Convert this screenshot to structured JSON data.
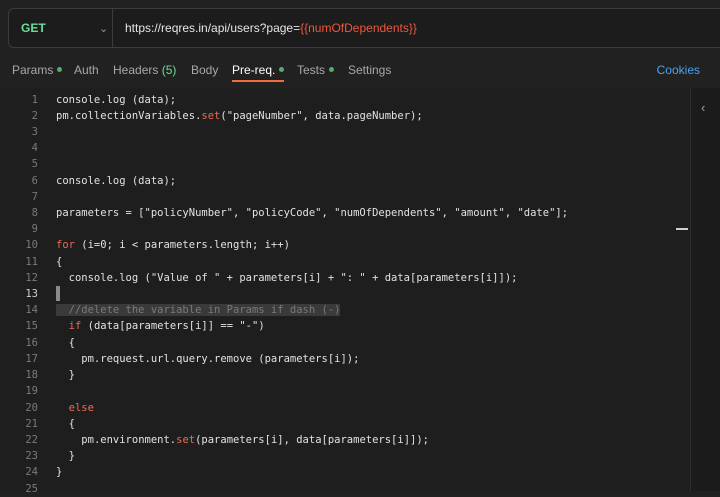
{
  "request": {
    "method": "GET",
    "url_prefix": "https://reqres.in/api/users?page=",
    "url_variable": "{{numOfDependents}}"
  },
  "tabs": {
    "params": "Params",
    "auth": "Auth",
    "headers": "Headers",
    "headers_count": "(5)",
    "body": "Body",
    "prereq": "Pre-req.",
    "tests": "Tests",
    "settings": "Settings",
    "cookies": "Cookies"
  },
  "editor": {
    "line_numbers": [
      "1",
      "2",
      "3",
      "4",
      "5",
      "6",
      "7",
      "8",
      "9",
      "10",
      "11",
      "12",
      "13",
      "14",
      "15",
      "16",
      "17",
      "18",
      "19",
      "20",
      "21",
      "22",
      "23",
      "24",
      "25"
    ],
    "lines": [
      "console.log (data);",
      "",
      "",
      "",
      "",
      "console.log (data);",
      "",
      "parameters = [\"policyNumber\", \"policyCode\", \"numOfDependents\", \"amount\", \"date\"];",
      "",
      "",
      "{",
      "  console.log (\"Value of \" + parameters[i] + \": \" + data[parameters[i]]);",
      "",
      "",
      "",
      "  {",
      "    pm.request.url.query.remove (parameters[i]);",
      "  }",
      "",
      "",
      "  {",
      "",
      "  }",
      "}",
      ""
    ],
    "line2_a": "pm.collectionVariables.",
    "line2_set": "set",
    "line2_b": "(\"pageNumber\", data.pageNumber);",
    "line10_for": "for",
    "line10_rest": " (i=0; i < parameters.length; i++)",
    "line14_comment": "  //delete the variable in Params if dash (-)",
    "line15_if": "if",
    "line15_rest": " (data[parameters[i]] == \"-\")",
    "line20_else": "else",
    "line22_a": "pm.environment.",
    "line22_set": "set",
    "line22_b": "(parameters[i], data[parameters[i]]);"
  },
  "icons": {
    "method_dropdown": "chevron-down-icon",
    "side_panel": "chevron-left-icon"
  },
  "colors": {
    "method": "#6bdd9a",
    "variable": "#f0563d",
    "keyword": "#f06a4c",
    "active_tab_underline": "#f26b3a",
    "cookies_link": "#4aa3f0",
    "status_dot": "#4caf6a"
  }
}
